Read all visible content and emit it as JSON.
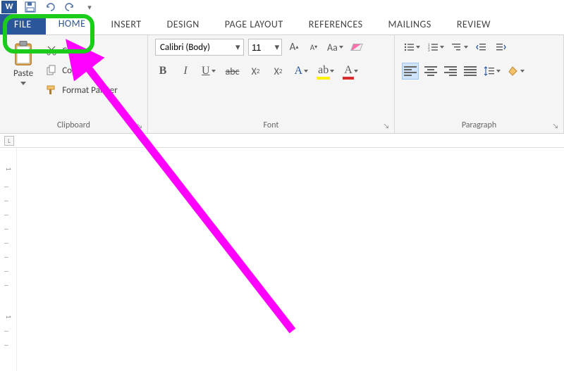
{
  "qat": {
    "save": "save-icon",
    "undo": "undo-icon",
    "redo": "redo-icon",
    "touch": "touch-icon"
  },
  "tabs": {
    "file": "FILE",
    "home": "HOME",
    "insert": "INSERT",
    "design": "DESIGN",
    "page_layout": "PAGE LAYOUT",
    "references": "REFERENCES",
    "mailings": "MAILINGS",
    "review": "REVIEW"
  },
  "clipboard": {
    "paste": "Paste",
    "cut": "Cut",
    "copy": "Copy",
    "format_painter": "Format Painter",
    "group_label": "Clipboard"
  },
  "font": {
    "name": "Calibri (Body)",
    "size": "11",
    "case_label": "Aa",
    "group_label": "Font"
  },
  "paragraph": {
    "group_label": "Paragraph"
  },
  "ruler": {
    "tab_corner": "L"
  },
  "vruler_marks": [
    "1",
    "1"
  ]
}
